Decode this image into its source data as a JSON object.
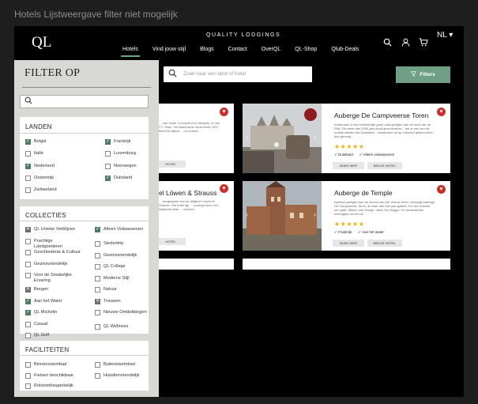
{
  "frame": {
    "title": "Hotels Lijstweergave filter niet mogelijk"
  },
  "header": {
    "logo": "QL",
    "brand": "QUALITY LODGINGS",
    "nav": [
      "Hotels",
      "Vind jouw stijl",
      "Blogs",
      "Contact",
      "OverQL",
      "QL-Shop",
      "Qlub-Deals"
    ],
    "active_nav": "Hotels",
    "language": "NL ▾",
    "icons": [
      "search-icon",
      "user-icon",
      "cart-icon"
    ]
  },
  "search": {
    "placeholder": "Zoek naar een land of hotel"
  },
  "filters_button": {
    "label": "Filters"
  },
  "cards": [
    {
      "title": "Auberge De Campveerse Toren",
      "description": "Andernach is een betrekkelijk grote stad gelegen aan de rand van de Eifel. De meer dan 2000 jaar oude geschiedenis – het is een van de oudste steden van Duitsland – maakt deel uit op cultureel gebied meer dan genoeg...",
      "stars": "★★★★★",
      "tags": [
        "Duitsland",
        "Alleen volwassenen"
      ],
      "book": "BOEK HIER",
      "view": "BEKIJK HOTEL"
    },
    {
      "title": "Auberge de Temple",
      "description": "Idyllisch gelegen aan de oevers van het Veerse meer, omvangt Auberge De Campveerse Toren, al meer dan 500 jaar gasten. En niet zomaar een gast, Willem van Oranje, ofwel 'De Zwijger' en Nederlandse koninglijes uit het 15...",
      "stars": "★★★★★",
      "tags": [
        "Frankrijk",
        "Aan het water"
      ],
      "book": "BOEK HIER",
      "view": "BEKIJK HOTEL"
    }
  ],
  "left_cards": [
    {
      "title": "",
      "description": "… van Hotel 't Lindenhof in Hengelo, et van CT. Sonk. Het historische ment sinds 1921, biedt 25 stijlvol … en unieke…",
      "view": "HOTEL"
    },
    {
      "title": "el Löwen & Strauss",
      "description": "… bergtoppen van de Allgäuer Löwen & Strauss. Het hotel ligt … omringd door een idyllische stad … charme…",
      "view": "HOTEL"
    }
  ],
  "filter_panel": {
    "title": "FILTER OP",
    "sections": {
      "landen": {
        "heading": "LANDEN",
        "col1": [
          {
            "label": "België",
            "state": "on"
          },
          {
            "label": "Italië",
            "state": "off"
          },
          {
            "label": "Nederland",
            "state": "on"
          },
          {
            "label": "Oostenrijk",
            "state": "off"
          },
          {
            "label": "Zwitserland",
            "state": "off"
          }
        ],
        "col2": [
          {
            "label": "Frankrijk",
            "state": "on"
          },
          {
            "label": "Luxemburg",
            "state": "off"
          },
          {
            "label": "Noorwegen",
            "state": "off"
          },
          {
            "label": "Duitsland",
            "state": "on"
          }
        ]
      },
      "collecties": {
        "heading": "COLLECTIES",
        "col1": [
          {
            "label": "QL Unieke Verblijven",
            "state": "x"
          },
          {
            "label": "Prachtige Landgoederen",
            "state": "off"
          },
          {
            "label": "Geschiedenis & Cultuur",
            "state": "off"
          },
          {
            "label": "Gezinsvriendelijk",
            "state": "off"
          },
          {
            "label": "Voor de Smakelijke Ervaring",
            "state": "off"
          },
          {
            "label": "Bergen",
            "state": "x"
          },
          {
            "label": "Aan het Water",
            "state": "on"
          },
          {
            "label": "QL Michelin",
            "state": "on"
          },
          {
            "label": "Casual",
            "state": "off"
          },
          {
            "label": "QL Golf",
            "state": "off"
          }
        ],
        "col2": [
          {
            "label": "Alleen Volwassenen",
            "state": "on"
          },
          {
            "label": "Stedentrip",
            "state": "off"
          },
          {
            "label": "Gezinsvriendelijk",
            "state": "off"
          },
          {
            "label": "QL College",
            "state": "off"
          },
          {
            "label": "Moderne Stijl",
            "state": "off"
          },
          {
            "label": "Natuur",
            "state": "off"
          },
          {
            "label": "Trouwen",
            "state": "x"
          },
          {
            "label": "Nieuwe Ontdekkingen",
            "state": "off"
          },
          {
            "label": "QL Wellness",
            "state": "off"
          }
        ]
      },
      "faciliteiten": {
        "heading": "FACILITEITEN",
        "col1": [
          {
            "label": "Binnenzwembad",
            "state": "off"
          },
          {
            "label": "Fietsen beschikbaar",
            "state": "off"
          },
          {
            "label": "Rolstoeltoegankelijk",
            "state": "off"
          }
        ],
        "col2": [
          {
            "label": "Buitenzwembad",
            "state": "off"
          },
          {
            "label": "Huisdiervriendelijk",
            "state": "off"
          }
        ]
      }
    }
  }
}
